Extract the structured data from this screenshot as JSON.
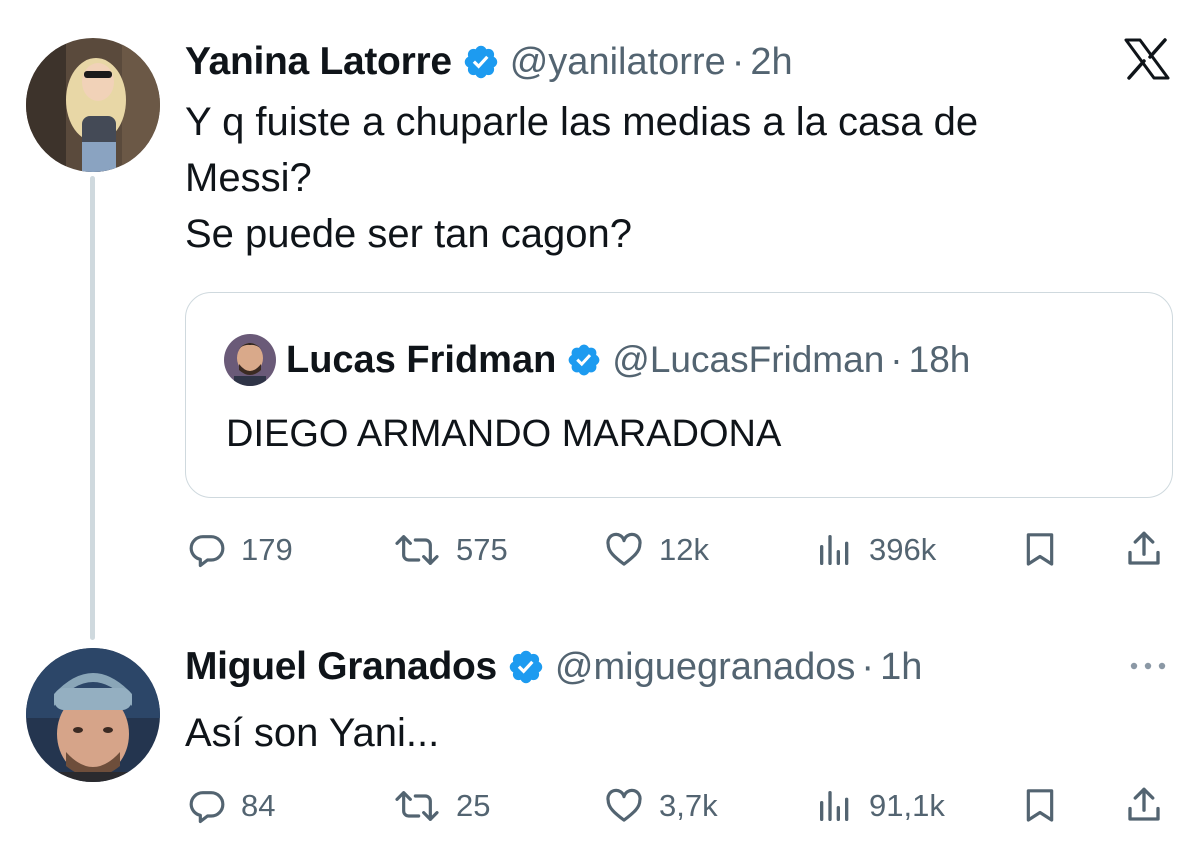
{
  "app": {
    "logo_icon": "x-logo-icon"
  },
  "colors": {
    "verified": "#1d9bf0",
    "muted": "#536471",
    "border": "#cfd9de"
  },
  "tweets": [
    {
      "name": "Yanina Latorre",
      "handle": "@yanilatorre",
      "separator": "·",
      "time": "2h",
      "text": "Y q fuiste a chuparle las medias a la casa de\nMessi?\nSe puede ser tan cagon?",
      "quote": {
        "name": "Lucas Fridman",
        "handle": "@LucasFridman",
        "separator": "·",
        "time": "18h",
        "text": "DIEGO ARMANDO MARADONA"
      },
      "metrics": {
        "replies": "179",
        "reposts": "575",
        "likes": "12k",
        "views": "396k"
      }
    },
    {
      "name": "Miguel Granados",
      "handle": "@miguegranados",
      "separator": "·",
      "time": "1h",
      "text": "Así son Yani...",
      "more_icon": "more-horizontal-icon",
      "metrics": {
        "replies": "84",
        "reposts": "25",
        "likes": "3,7k",
        "views": "91,1k"
      }
    }
  ]
}
